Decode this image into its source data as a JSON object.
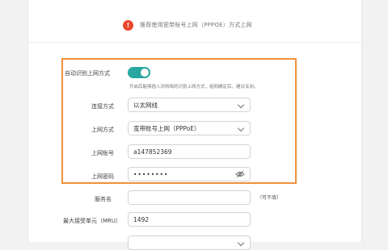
{
  "notice": {
    "badge": "!",
    "text": "推荐使用宽带账号上网（PPPOE）方式上网"
  },
  "auto_detect": {
    "label": "自动识别上网方式",
    "enabled": true,
    "hint": "开启后能够插入对网络的识别上网方式，组网确定后，建议关闭。"
  },
  "form": {
    "connection_type": {
      "label": "连接方式",
      "value": "以太网线"
    },
    "internet_mode": {
      "label": "上网方式",
      "value": "宽带账号上网（PPPoE）"
    },
    "account": {
      "label": "上网账号",
      "value": "a147852369"
    },
    "password": {
      "label": "上网密码",
      "value": "••••••••"
    },
    "service_name": {
      "label": "服务名",
      "value": "",
      "optional": "（可不填）"
    },
    "mru": {
      "label": "最大接受单元（MRU）",
      "value": "1492"
    }
  },
  "colors": {
    "accent": "#2aa7a0",
    "highlight_border": "#f0913b",
    "badge": "#e8472b"
  }
}
